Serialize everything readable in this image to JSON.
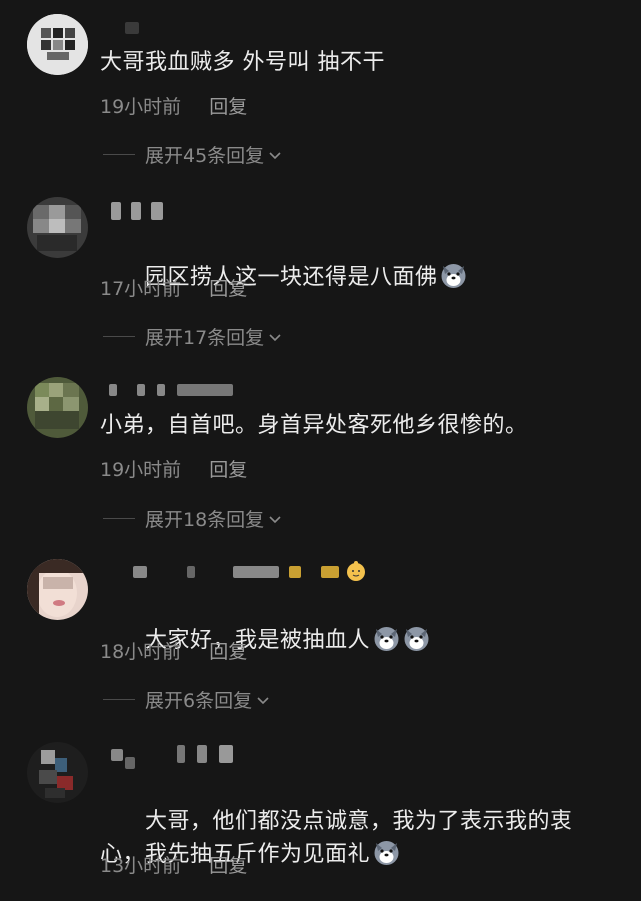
{
  "comments": [
    {
      "text": "大哥我血贼多 外号叫 抽不干",
      "time": "19小时前",
      "reply_label": "回复",
      "expand_label": "展开45条回复"
    },
    {
      "text": "园区捞人这一块还得是八面佛",
      "emojis": [
        "husky-emoji"
      ],
      "time": "17小时前",
      "reply_label": "回复",
      "expand_label": "展开17条回复"
    },
    {
      "text": "小弟，自首吧。身首异处客死他乡很惨的。",
      "time": "19小时前",
      "reply_label": "回复",
      "expand_label": "展开18条回复"
    },
    {
      "text": "大家好，我是被抽血人",
      "emojis": [
        "husky-emoji",
        "husky-emoji"
      ],
      "time": "18小时前",
      "reply_label": "回复",
      "expand_label": "展开6条回复"
    },
    {
      "text": "大哥，他们都没点诚意，我为了表示我的衷\n心，我先抽五斤作为见面礼",
      "emojis": [
        "husky-emoji"
      ],
      "time": "13小时前",
      "reply_label": "回复"
    }
  ]
}
